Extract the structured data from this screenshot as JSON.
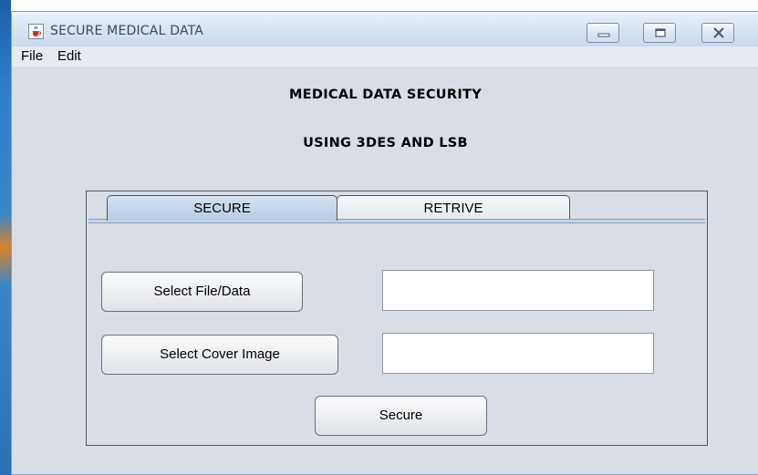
{
  "window": {
    "title": "SECURE MEDICAL DATA",
    "icon": "java-cup-icon",
    "controls": [
      "minimize-icon",
      "maximize-icon",
      "close-icon"
    ]
  },
  "menubar": {
    "items": [
      "File",
      "Edit"
    ]
  },
  "header": {
    "line1": "MEDICAL DATA SECURITY",
    "line2": "USING 3DES AND LSB"
  },
  "tabs": {
    "items": [
      {
        "label": "SECURE",
        "selected": true
      },
      {
        "label": "RETRIVE",
        "selected": false
      }
    ]
  },
  "secure_panel": {
    "select_file_label": "Select File/Data",
    "file_field_value": "",
    "select_cover_label": "Select Cover Image",
    "cover_field_value": "",
    "secure_label": "Secure"
  }
}
